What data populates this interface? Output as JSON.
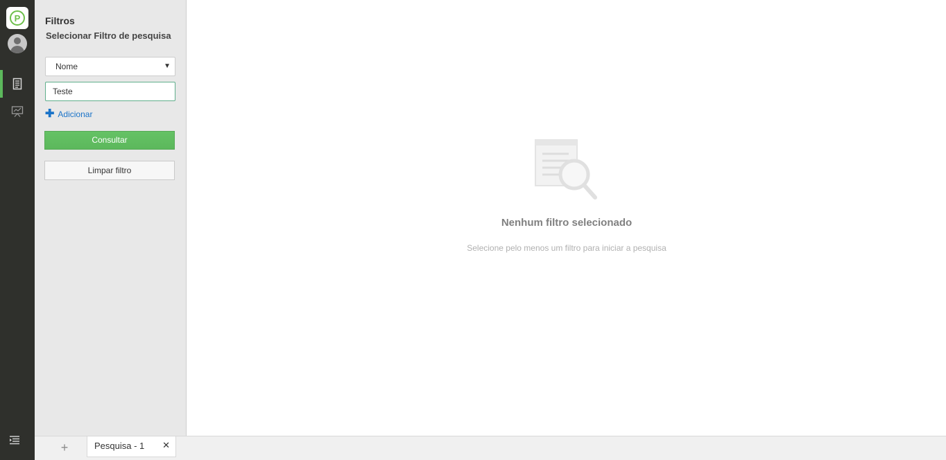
{
  "app": {
    "logo_letter": "P"
  },
  "filters": {
    "title": "Filtros",
    "subtitle": "Selecionar Filtro de pesquisa",
    "field_select_value": "Nome",
    "field_input_value": "Teste",
    "add_label": "Adicionar",
    "consult_label": "Consultar",
    "clear_label": "Limpar filtro"
  },
  "empty_state": {
    "title": "Nenhum filtro selecionado",
    "description": "Selecione pelo menos um filtro para iniciar a pesquisa"
  },
  "tabs": {
    "new_tab_symbol": "+",
    "items": [
      {
        "label": "Pesquisa - 1",
        "close_symbol": "✕"
      }
    ]
  },
  "colors": {
    "rail": "#2f302c",
    "accent": "#5cb85c",
    "link": "#1a73c8"
  },
  "icons": {
    "rail": [
      "document-icon",
      "presentation-icon"
    ],
    "bottom": "menu-collapse-icon",
    "empty": "document-search-icon"
  }
}
